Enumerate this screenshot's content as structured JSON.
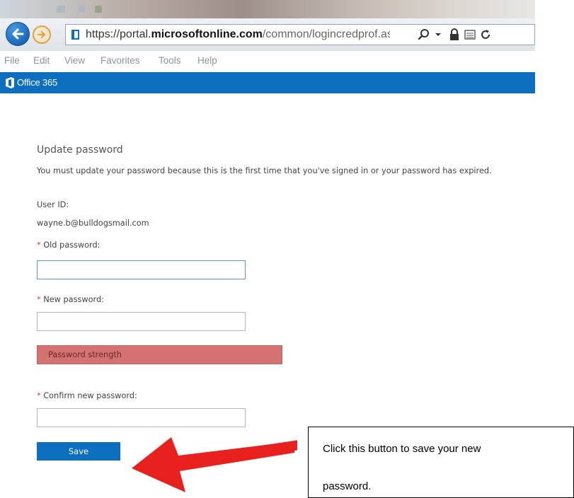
{
  "browser": {
    "url_segments": [
      {
        "text": "https://portal.",
        "kind": "base"
      },
      {
        "text": "microsoftonline.com",
        "kind": "domain"
      },
      {
        "text": "/common/logincredprof.aspx?ru=https://l",
        "kind": "path"
      }
    ],
    "menu": [
      "File",
      "Edit",
      "View",
      "Favorites",
      "Tools",
      "Help"
    ]
  },
  "app": {
    "name": "Office 365",
    "brand_color": "#0b6ebf"
  },
  "form": {
    "title": "Update password",
    "intro": "You must update your password because this is the first time that you've signed in or your password has expired.",
    "user_id_label": "User ID:",
    "user_id_value": "wayne.b@bulldogsmail.com",
    "required_mark": "*",
    "old_password_label": "Old password:",
    "new_password_label": "New password:",
    "password_strength": "Password strength",
    "confirm_password_label": "Confirm new password:",
    "save_label": "Save"
  },
  "annotation": {
    "line1": "Click this button to save your new",
    "line2": "password.",
    "arrow_color": "#e8201e"
  },
  "icons": {
    "back": "back-arrow-icon",
    "forward": "forward-arrow-icon",
    "page": "office-page-icon",
    "search": "search-icon",
    "dropdown": "chevron-down-icon",
    "lock": "lock-icon",
    "compat": "compatibility-view-icon",
    "refresh": "refresh-icon"
  }
}
